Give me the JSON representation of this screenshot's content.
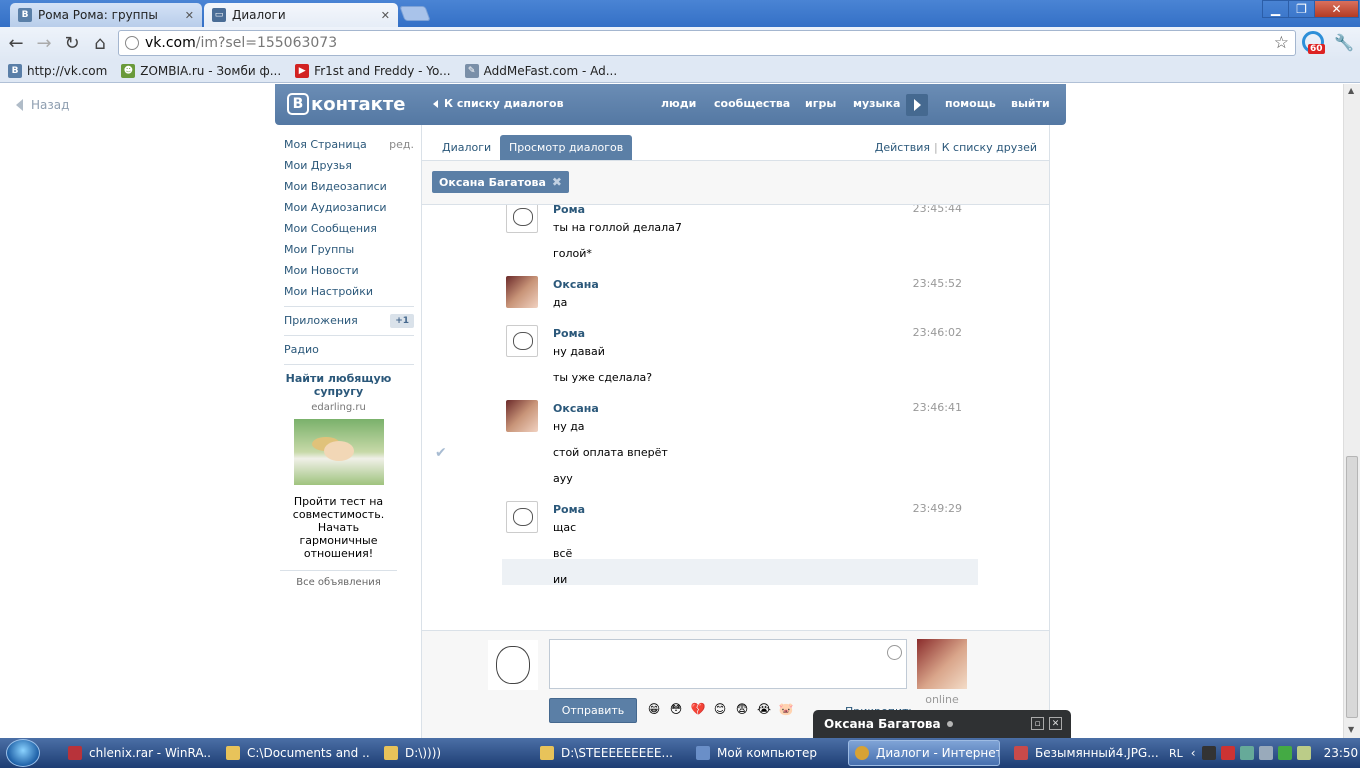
{
  "browser": {
    "tabs": [
      {
        "title": "Рома Рома: группы",
        "favicon": "B",
        "active": false
      },
      {
        "title": "Диалоги",
        "favicon": "chat",
        "active": true
      }
    ],
    "url_host": "vk.com",
    "url_path": "/im?sel=155063073",
    "ext_badge": "60",
    "bookmarks": [
      {
        "label": "http://vk.com",
        "icon": "B",
        "color": "#5a7fa8"
      },
      {
        "label": "ZOMBIA.ru - Зомби ф...",
        "icon": "zombie",
        "color": "#6a9a3a"
      },
      {
        "label": "Fr1st and Freddy - Yo...",
        "icon": "youtube",
        "color": "#d22222"
      },
      {
        "label": "AddMeFast.com - Ad...",
        "icon": "addmefast",
        "color": "#7a8fa8"
      }
    ]
  },
  "page": {
    "back_label": "Назад",
    "logo_text": "контакте",
    "logo_letter": "В",
    "back_to_dialogs": "К списку диалогов",
    "top_nav": [
      "люди",
      "сообщества",
      "игры",
      "музыка",
      "помощь",
      "выйти"
    ]
  },
  "leftnav": {
    "items": [
      {
        "label": "Моя Страница",
        "extra": "ред."
      },
      {
        "label": "Мои Друзья"
      },
      {
        "label": "Мои Видеозаписи"
      },
      {
        "label": "Мои Аудиозаписи"
      },
      {
        "label": "Мои Сообщения"
      },
      {
        "label": "Мои Группы"
      },
      {
        "label": "Мои Новости"
      },
      {
        "label": "Мои Настройки"
      }
    ],
    "apps_label": "Приложения",
    "apps_badge": "+1",
    "radio_label": "Радио"
  },
  "ad": {
    "title": "Найти любящую супругу",
    "domain": "edarling.ru",
    "text": "Пройти тест на совместимость. Начать гармоничные отношения!",
    "all_ads": "Все объявления"
  },
  "dialogs": {
    "tab_dialogs": "Диалоги",
    "tab_view": "Просмотр диалогов",
    "actions": "Действия",
    "friends_list": "К списку друзей",
    "recipient": "Оксана Багатова"
  },
  "messages": [
    {
      "author": "Рома",
      "avatar": "roma",
      "time": "23:45:44",
      "lines": [
        "ты на голлой делала7",
        "голой*"
      ]
    },
    {
      "author": "Оксана",
      "avatar": "oksana",
      "time": "23:45:52",
      "lines": [
        "да"
      ]
    },
    {
      "author": "Рома",
      "avatar": "roma",
      "time": "23:46:02",
      "lines": [
        "ну давай",
        "ты уже сделала?"
      ]
    },
    {
      "author": "Оксана",
      "avatar": "oksana",
      "time": "23:46:41",
      "lines": [
        "ну да",
        "стой оплата вперёт",
        "ауу"
      ]
    },
    {
      "author": "Рома",
      "avatar": "roma",
      "time": "23:49:29",
      "lines": [
        "щас",
        "всё",
        "ии"
      ]
    }
  ],
  "composer": {
    "send_label": "Отправить",
    "attach_label": "Прикрепить",
    "peer_status": "online",
    "smileys": [
      "😁",
      "😳",
      "💔",
      "😊",
      "😨",
      "😭",
      "🐷"
    ]
  },
  "chat_popup": {
    "name": "Оксана Багатова"
  },
  "taskbar": {
    "tasks": [
      {
        "label": "chlenix.rar - WinRA...",
        "color": "#b8333a"
      },
      {
        "label": "C:\\Documents and ...",
        "color": "#e8c35a"
      },
      {
        "label": "D:\\))))",
        "color": "#e8c35a"
      },
      {
        "label": "D:\\STEEEEEEEEE...",
        "color": "#e8c35a"
      },
      {
        "label": "Мой компьютер",
        "color": "#6a8fc8"
      },
      {
        "label": "Диалоги - Интернет",
        "color": "#d7a234",
        "active": true
      },
      {
        "label": "Безымянный4.JPG...",
        "color": "#c84a4a"
      }
    ],
    "lang": "RL",
    "clock": "23:50"
  }
}
